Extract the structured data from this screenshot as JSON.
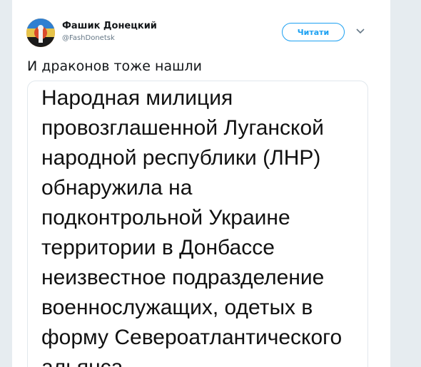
{
  "author": {
    "name": "Фашик Донецкий",
    "handle": "@FashDonetsk"
  },
  "follow_button": {
    "label": "Читати"
  },
  "icons": {
    "caret": "chevron-down-icon",
    "avatar": "avatar-image"
  },
  "tweet": {
    "text": "И драконов тоже нашли"
  },
  "media": {
    "lines": [
      "Народная милиция",
      "провозглашенной Луганской",
      "народной республики (ЛНР)",
      "обнаружила на",
      "подконтрольной Украине",
      "территории в Донбассе",
      "неизвестное подразделение",
      "военнослужащих, одетых в",
      "форму Североатлантического",
      "альянса"
    ]
  },
  "colors": {
    "accent": "#1da1f2",
    "background": "#e6ecf0",
    "text": "#14171a",
    "muted": "#657786"
  }
}
